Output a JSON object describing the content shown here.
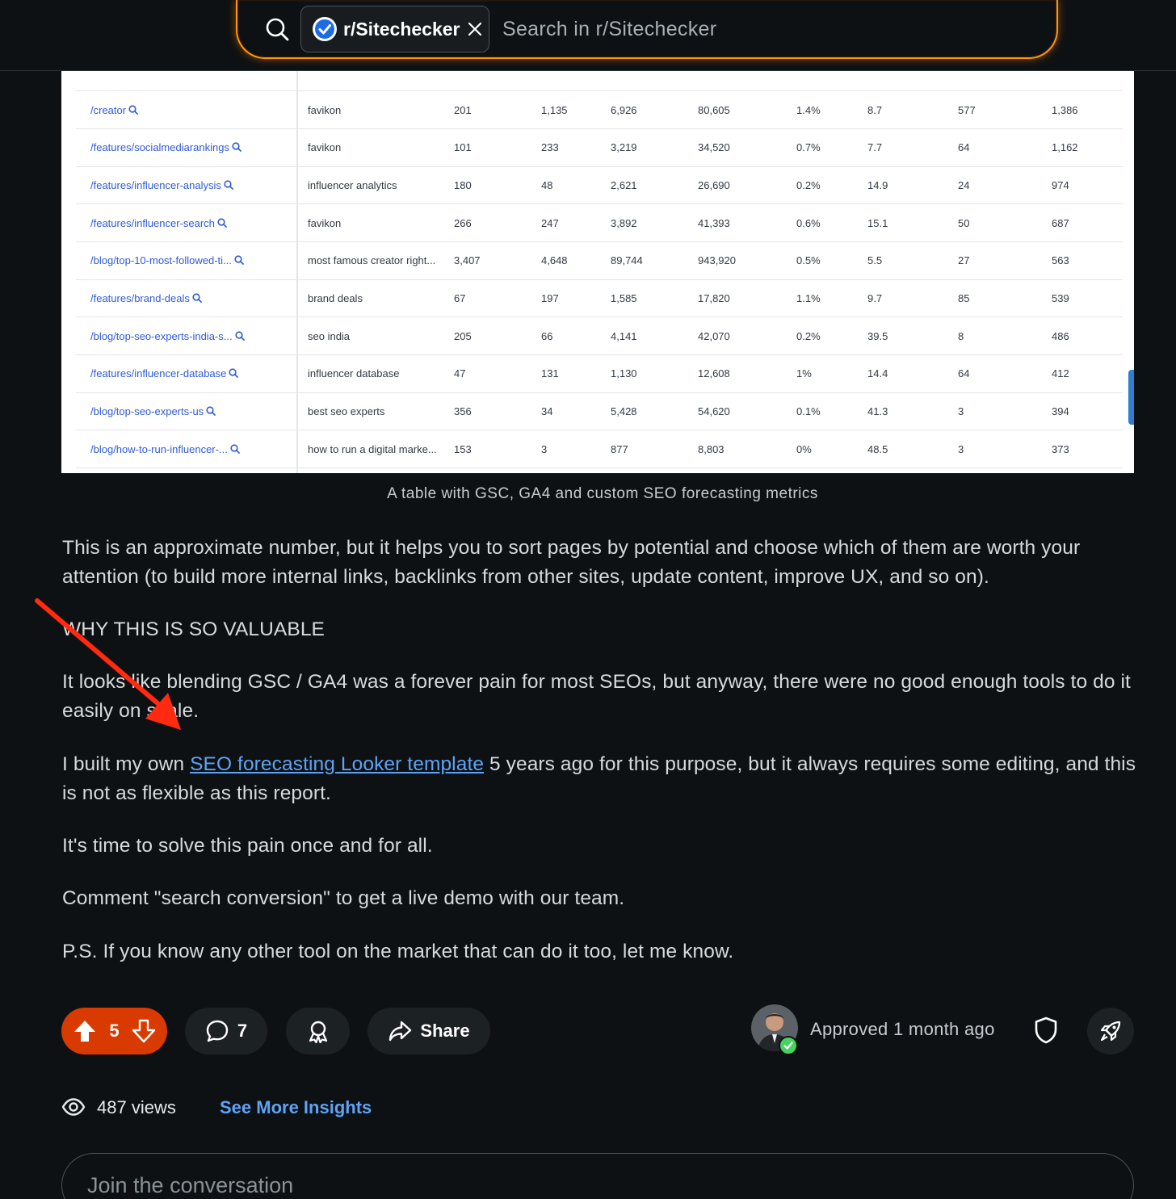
{
  "header": {
    "community_chip": "r/Sitechecker",
    "search_placeholder": "Search in r/Sitechecker",
    "accent_color": "#ff9b00"
  },
  "table": {
    "rows": [
      [
        "/creator",
        "favikon",
        "201",
        "1,135",
        "6,926",
        "80,605",
        "1.4%",
        "8.7",
        "577",
        "1,386"
      ],
      [
        "/features/socialmediarankings",
        "favikon",
        "101",
        "233",
        "3,219",
        "34,520",
        "0.7%",
        "7.7",
        "64",
        "1,162"
      ],
      [
        "/features/influencer-analysis",
        "influencer analytics",
        "180",
        "48",
        "2,621",
        "26,690",
        "0.2%",
        "14.9",
        "24",
        "974"
      ],
      [
        "/features/influencer-search",
        "favikon",
        "266",
        "247",
        "3,892",
        "41,393",
        "0.6%",
        "15.1",
        "50",
        "687"
      ],
      [
        "/blog/top-10-most-followed-ti...",
        "most famous creator right...",
        "3,407",
        "4,648",
        "89,744",
        "943,920",
        "0.5%",
        "5.5",
        "27",
        "563"
      ],
      [
        "/features/brand-deals",
        "brand deals",
        "67",
        "197",
        "1,585",
        "17,820",
        "1.1%",
        "9.7",
        "85",
        "539"
      ],
      [
        "/blog/top-seo-experts-india-s...",
        "seo india",
        "205",
        "66",
        "4,141",
        "42,070",
        "0.2%",
        "39.5",
        "8",
        "486"
      ],
      [
        "/features/influencer-database",
        "influencer database",
        "47",
        "131",
        "1,130",
        "12,608",
        "1%",
        "14.4",
        "64",
        "412"
      ],
      [
        "/blog/top-seo-experts-us",
        "best seo experts",
        "356",
        "34",
        "5,428",
        "54,620",
        "0.1%",
        "41.3",
        "3",
        "394"
      ],
      [
        "/blog/how-to-run-influencer-...",
        "how to run a digital marke...",
        "153",
        "3",
        "877",
        "8,803",
        "0%",
        "48.5",
        "3",
        "373"
      ]
    ],
    "caption": "A table with GSC, GA4 and custom SEO forecasting metrics"
  },
  "post": {
    "p1": "This is an approximate number, but it helps you to sort pages by potential and choose which of them are worth your attention (to build more internal links, backlinks from other sites, update content, improve UX, and so on).",
    "heading": "WHY THIS IS SO VALUABLE",
    "p2": "It looks like blending GSC / GA4 was a forever pain for most SEOs, but anyway, there were no good enough tools to do it easily on scale.",
    "p3_before": "I built my own ",
    "p3_link": "SEO forecasting Looker template",
    "p3_after": " 5 years ago for this purpose, but it always requires some editing, and this is not as flexible as this report.",
    "p4": "It's time to solve this pain once and for all.",
    "p5": "Comment \"search conversion\" to get a live demo with our team.",
    "p6": "P.S. If you know any other tool on the market that can do it too, let me know."
  },
  "actions": {
    "vote_count": "5",
    "comment_count": "7",
    "share_label": "Share",
    "approved_text": "Approved 1 month ago",
    "upvote_color": "#d93a00"
  },
  "insights": {
    "views": "487 views",
    "see_more": "See More Insights"
  },
  "comment": {
    "placeholder": "Join the conversation"
  }
}
